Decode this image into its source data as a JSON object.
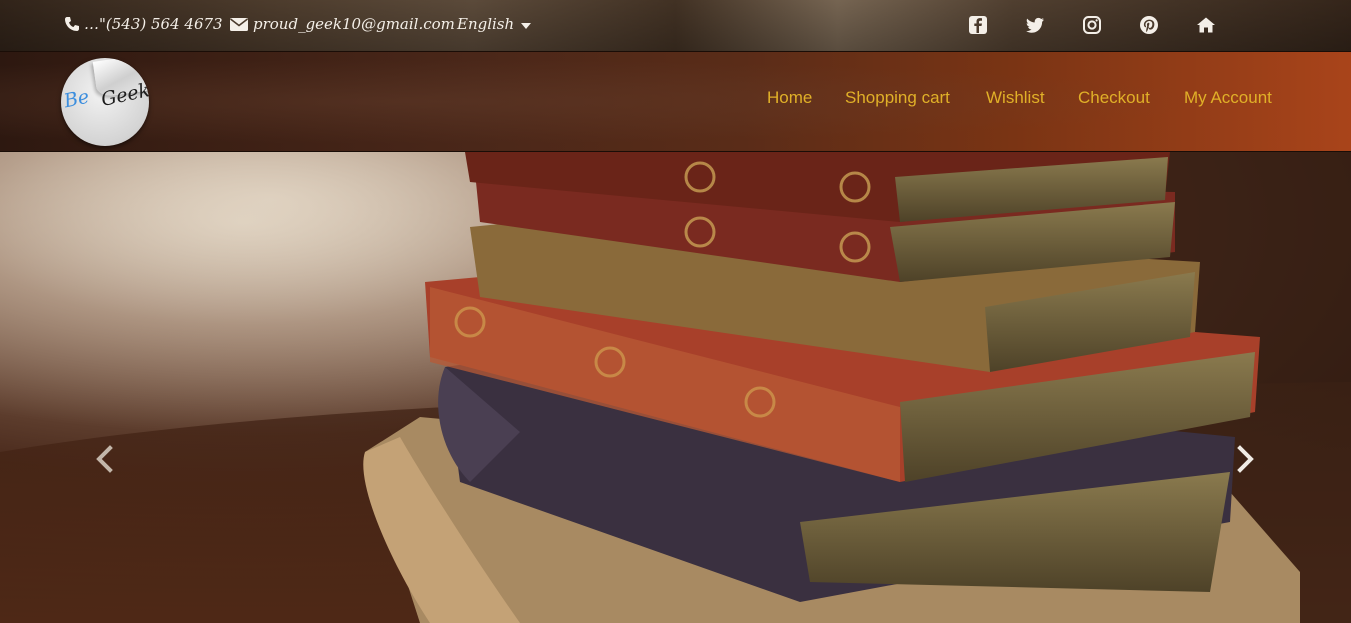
{
  "topbar": {
    "phone": "…\"(543) 564 4673",
    "email": "proud_geek10@gmail.com",
    "language": "English",
    "icons": [
      "phone-icon",
      "envelope-icon",
      "facebook-icon",
      "twitter-icon",
      "instagram-icon",
      "pinterest-icon",
      "home-icon"
    ]
  },
  "logo": {
    "be": "Be",
    "geek": "Geek"
  },
  "nav": {
    "items": [
      {
        "label": "Home"
      },
      {
        "label": "Shopping cart"
      },
      {
        "label": "Wishlist"
      },
      {
        "label": "Checkout"
      },
      {
        "label": "My Account"
      }
    ]
  },
  "carousel": {
    "prev_icon": "chevron-left-icon",
    "next_icon": "chevron-right-icon"
  },
  "colors": {
    "nav_link": "#e0b028",
    "topbar_text": "#f4efe8",
    "logo_be": "#3c8ede"
  }
}
